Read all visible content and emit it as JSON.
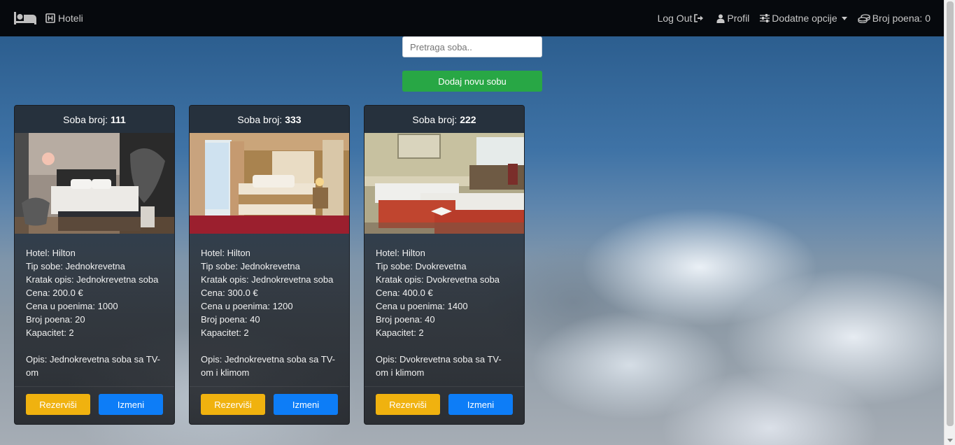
{
  "navbar": {
    "brand_icon": "bed-icon",
    "hotels_label": "Hoteli",
    "logout_label": "Log Out",
    "profile_label": "Profil",
    "options_label": "Dodatne opcije",
    "points_label": "Broj poena: 0"
  },
  "search": {
    "placeholder": "Pretraga soba.."
  },
  "add_room_label": "Dodaj novu sobu",
  "colors": {
    "add": "#28a745",
    "reserve": "#f0b20f",
    "edit": "#0d7df7",
    "navbar": "#06090d"
  },
  "rooms": [
    {
      "header_label": "Soba broj:",
      "number": "111",
      "hotel": "Hotel: Hilton",
      "type": "Tip sobe: Jednokrevetna",
      "short": "Kratak opis: Jednokrevetna soba",
      "price": "Cena: 200.0 €",
      "price_points": "Cena u poenima: 1000",
      "points": "Broj poena: 20",
      "capacity": "Kapacitet: 2",
      "description": "Opis: Jednokrevetna soba sa TV-om",
      "reserve_label": "Rezerviši",
      "edit_label": "Izmeni"
    },
    {
      "header_label": "Soba broj:",
      "number": "333",
      "hotel": "Hotel: Hilton",
      "type": "Tip sobe: Jednokrevetna",
      "short": "Kratak opis: Jednokrevetna soba",
      "price": "Cena: 300.0 €",
      "price_points": "Cena u poenima: 1200",
      "points": "Broj poena: 40",
      "capacity": "Kapacitet: 2",
      "description": "Opis: Jednokrevetna soba sa TV-om i klimom",
      "reserve_label": "Rezerviši",
      "edit_label": "Izmeni"
    },
    {
      "header_label": "Soba broj:",
      "number": "222",
      "hotel": "Hotel: Hilton",
      "type": "Tip sobe: Dvokrevetna",
      "short": "Kratak opis: Dvokrevetna soba",
      "price": "Cena: 400.0 €",
      "price_points": "Cena u poenima: 1400",
      "points": "Broj poena: 40",
      "capacity": "Kapacitet: 2",
      "description": "Opis: Dvokrevetna soba sa TV-om i klimom",
      "reserve_label": "Rezerviši",
      "edit_label": "Izmeni"
    }
  ]
}
